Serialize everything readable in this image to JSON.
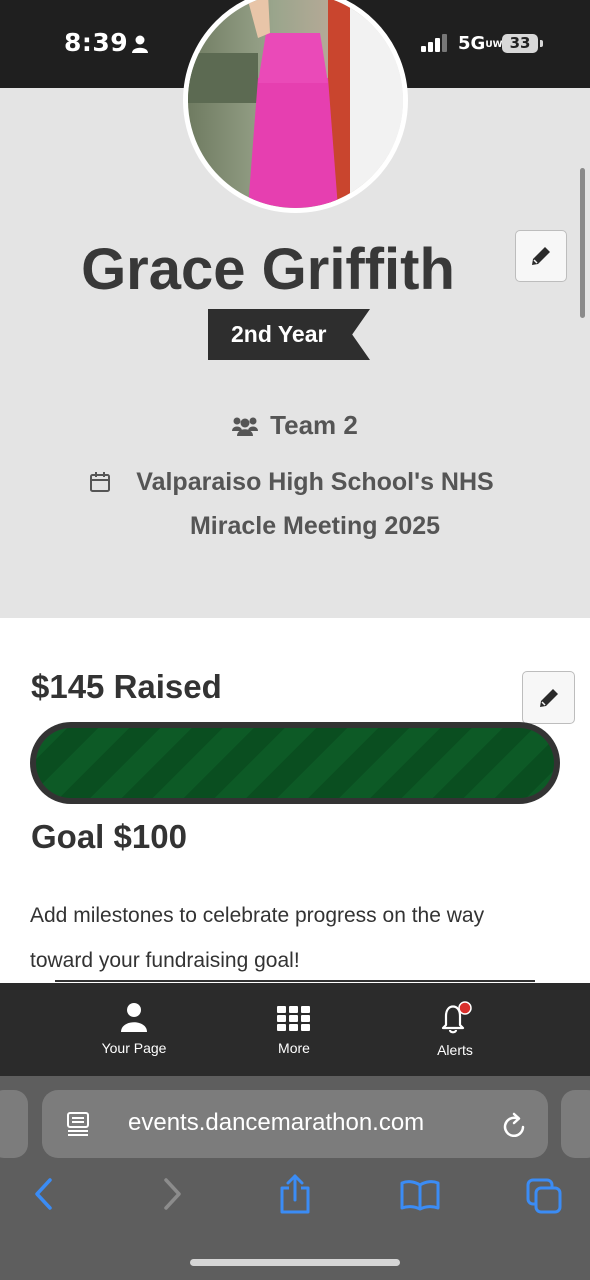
{
  "status_bar": {
    "time": "8:39",
    "network": "5G",
    "network_suffix": "UW",
    "battery": "33"
  },
  "profile": {
    "name": "Grace Griffith",
    "year_badge": "2nd Year",
    "team": "Team 2",
    "event": "Valparaiso High School's NHS Miracle Meeting 2025"
  },
  "fundraising": {
    "raised_label": "$145 Raised",
    "goal_label": "Goal $100",
    "progress_fraction": 1.0,
    "progress_color": "#0d5a26",
    "milestone_prompt": "Add milestones to celebrate progress on the way toward your fundraising goal!"
  },
  "bottom_nav": {
    "items": [
      {
        "label": "Your Page",
        "icon": "user-icon"
      },
      {
        "label": "More",
        "icon": "grid-icon"
      },
      {
        "label": "Alerts",
        "icon": "bell-icon",
        "has_badge": true
      }
    ]
  },
  "browser": {
    "url": "events.dancemarathon.com",
    "toolbar": [
      "back-icon",
      "forward-icon",
      "share-icon",
      "bookmarks-icon",
      "tabs-icon"
    ],
    "accent_color": "#3b8cf5"
  }
}
